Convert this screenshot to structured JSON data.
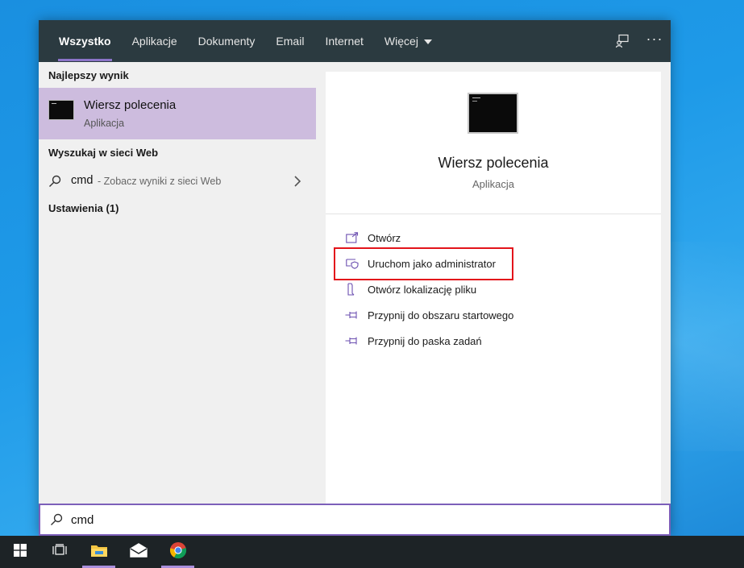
{
  "tabs": [
    {
      "label": "Wszystko",
      "active": true
    },
    {
      "label": "Aplikacje"
    },
    {
      "label": "Dokumenty"
    },
    {
      "label": "Email"
    },
    {
      "label": "Internet"
    },
    {
      "label": "Więcej"
    }
  ],
  "header_icons": [
    "feedback-icon",
    "more-options-icon"
  ],
  "header_more_text": "···",
  "left": {
    "best_match_heading": "Najlepszy wynik",
    "best_match": {
      "name": "Wiersz polecenia",
      "kind": "Aplikacja",
      "icon": "command-prompt-icon"
    },
    "web_heading": "Wyszukaj w sieci Web",
    "web_item": {
      "query": "cmd",
      "hint": "- Zobacz wyniki z sieci Web"
    },
    "settings_heading": "Ustawienia (1)"
  },
  "right": {
    "title": "Wiersz polecenia",
    "kind": "Aplikacja",
    "actions": [
      {
        "label": "Otwórz",
        "icon": "open-icon"
      },
      {
        "label": "Uruchom jako administrator",
        "icon": "run-as-admin-icon",
        "highlighted": true
      },
      {
        "label": "Otwórz lokalizację pliku",
        "icon": "file-location-icon"
      },
      {
        "label": "Przypnij do obszaru startowego",
        "icon": "pin-icon"
      },
      {
        "label": "Przypnij do paska zadań",
        "icon": "pin-icon"
      }
    ]
  },
  "search": {
    "value": "cmd"
  },
  "taskbar": [
    {
      "name": "start-button",
      "icon": "windows-logo-icon"
    },
    {
      "name": "task-view-button",
      "icon": "task-view-icon"
    },
    {
      "name": "file-explorer-button",
      "icon": "folder-icon",
      "running": true
    },
    {
      "name": "mail-button",
      "icon": "mail-icon"
    },
    {
      "name": "chrome-button",
      "icon": "chrome-icon",
      "running": true
    }
  ],
  "colors": {
    "accent": "#7c5fb9",
    "selection": "#cdbcde",
    "highlight_box": "#e3141b",
    "tabbar": "#2b3a40",
    "taskbar": "#1d2326"
  }
}
